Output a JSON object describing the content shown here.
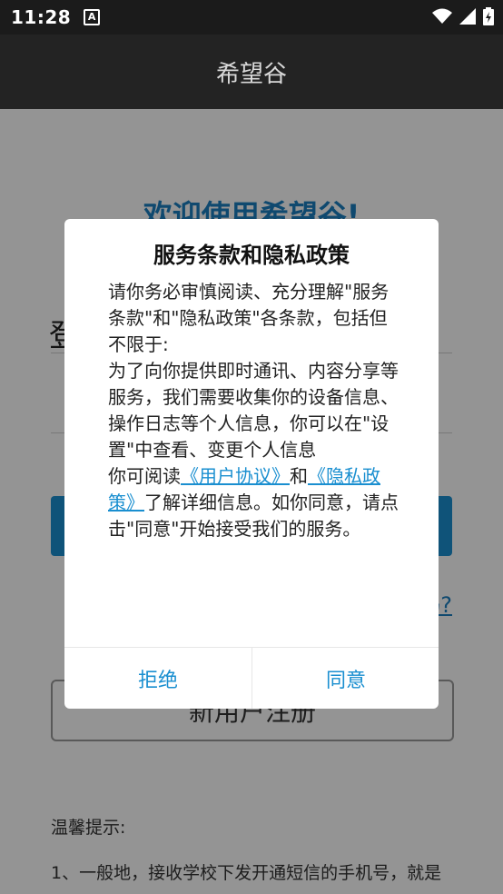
{
  "status_bar": {
    "time": "11:28",
    "notification_icon_letter": "A",
    "icons": [
      "wifi-icon",
      "signal-icon",
      "battery-charging-icon"
    ]
  },
  "app_bar": {
    "title": "希望谷"
  },
  "background": {
    "welcome": "欢迎使用希望谷!",
    "login_label": "登",
    "forgot_label": "码?",
    "register_label": "新用户注册",
    "tips_title": "温馨提示:",
    "tips_line1": "1、一般地，接收学校下发开通短信的手机号，就是"
  },
  "dialog": {
    "title": "服务条款和隐私政策",
    "para1": "请你务必审慎阅读、充分理解\"服务条款\"和\"隐私政策\"各条款，包括但不限于:",
    "para2": "为了向你提供即时通讯、内容分享等服务，我们需要收集你的设备信息、操作日志等个人信息，你可以在\"设置\"中查看、变更个人信息",
    "para3_prefix": "你可阅读",
    "user_agreement_link": "《用户协议》",
    "and_text": "和",
    "privacy_policy_link": "《隐私政策》",
    "para3_suffix": "了解详细信息。如你同意，请点击\"同意\"开始接受我们的服务。",
    "reject_label": "拒绝",
    "agree_label": "同意"
  },
  "colors": {
    "accent": "#1a8fd0",
    "app_bar": "#232323",
    "overlay": "rgba(0,0,0,0.42)"
  }
}
